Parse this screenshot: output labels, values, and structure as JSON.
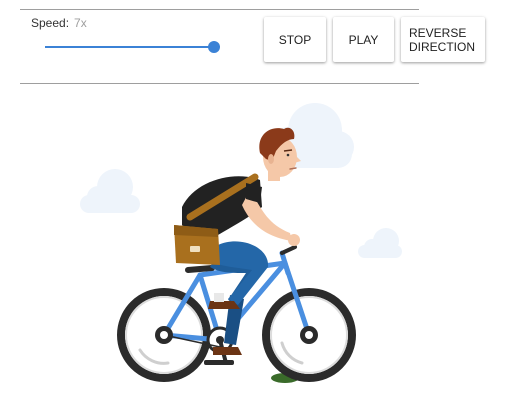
{
  "controls": {
    "speed_label": "Speed:",
    "speed_value": "7x",
    "speed_level": 1.0,
    "stop_label": "STOP",
    "play_label": "PLAY",
    "reverse_label": "REVERSE DIRECTION"
  },
  "colors": {
    "accent": "#3b82d6",
    "bike_frame": "#4a8fe0",
    "tire": "#2b2b2b",
    "cloud": "#eef4fb",
    "shirt": "#222222",
    "jeans": "#1f5d99",
    "bag": "#a9701e",
    "hair": "#8b3a1a",
    "skin": "#f5c8a8",
    "shoe": "#6b3414"
  },
  "scene": {
    "icons": [
      "cloud-icon",
      "cyclist-illustration",
      "bicycle-illustration"
    ]
  }
}
